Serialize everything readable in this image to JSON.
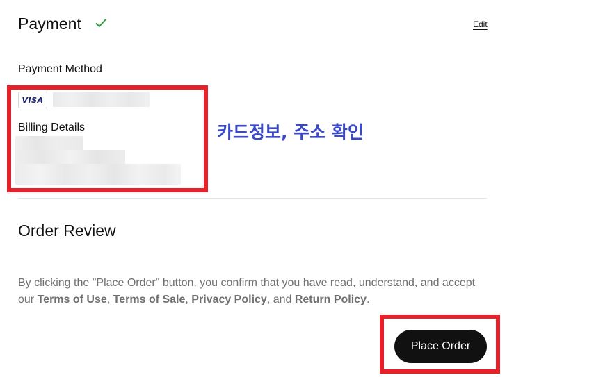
{
  "payment": {
    "title": "Payment",
    "edit_label": "Edit",
    "method_label": "Payment Method",
    "card_brand": "VISA",
    "billing_label": "Billing Details"
  },
  "annotation": {
    "text": "카드정보, 주소 확인",
    "color": "#3a49c9",
    "highlight_color": "#e8202a"
  },
  "order_review": {
    "title": "Order Review",
    "legal": {
      "prefix": "By clicking the \"Place Order\" button, you confirm that you have read, understand, and accept our ",
      "terms_of_use": "Terms of Use",
      "sep1": ", ",
      "terms_of_sale": "Terms of Sale",
      "sep2": ", ",
      "privacy_policy": "Privacy Policy",
      "sep3": ", and ",
      "return_policy": "Return Policy",
      "suffix": "."
    },
    "place_order_label": "Place Order"
  },
  "icons": {
    "check": "check-icon",
    "check_color": "#2e9e3e"
  }
}
